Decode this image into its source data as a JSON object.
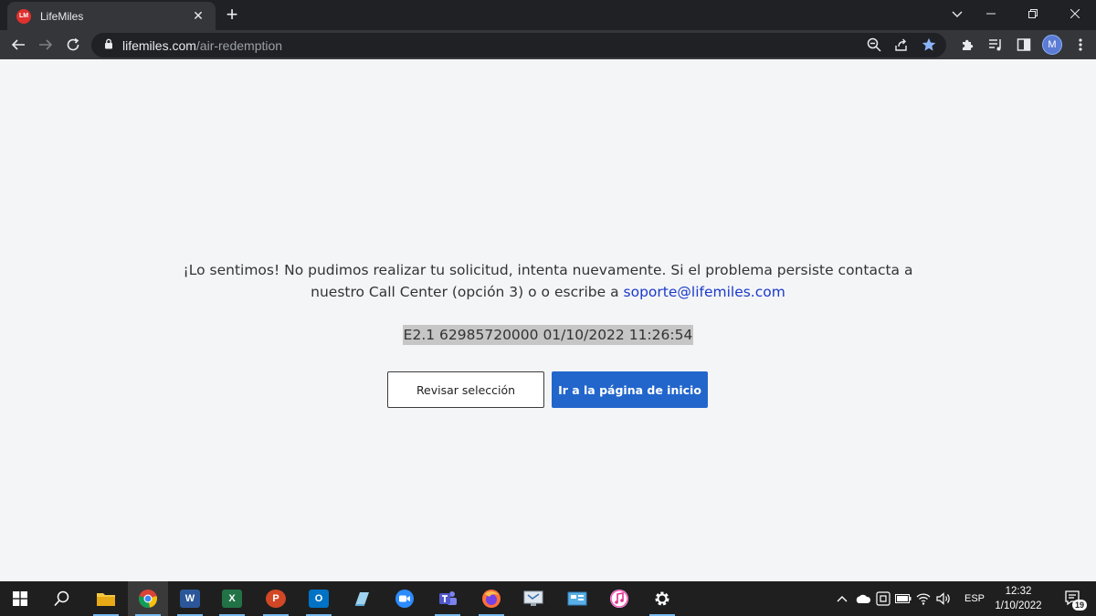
{
  "browser": {
    "tab_title": "LifeMiles",
    "favicon_text": "LM",
    "url_host": "lifemiles.com",
    "url_path": "/air-redemption",
    "profile_initial": "M"
  },
  "page": {
    "message_line1": "¡Lo sentimos! No pudimos realizar tu solicitud, intenta nuevamente. Si el problema persiste contacta a",
    "message_line2": "nuestro Call Center (opción 3) o o escribe a ",
    "support_email": "soporte@lifemiles.com",
    "error_code": "E2.1 62985720000 01/10/2022 11:26:54",
    "review_button": "Revisar selección",
    "home_button": "Ir a la página de inicio"
  },
  "taskbar": {
    "apps": [
      {
        "name": "file-explorer-icon",
        "label": ""
      },
      {
        "name": "chrome-icon",
        "label": ""
      },
      {
        "name": "word-icon",
        "label": "W"
      },
      {
        "name": "excel-icon",
        "label": "X"
      },
      {
        "name": "powerpoint-icon",
        "label": "P"
      },
      {
        "name": "outlook-icon",
        "label": "O"
      },
      {
        "name": "notepad-icon",
        "label": ""
      },
      {
        "name": "zoom-icon",
        "label": ""
      },
      {
        "name": "teams-icon",
        "label": ""
      },
      {
        "name": "firefox-icon",
        "label": ""
      },
      {
        "name": "remote-desktop-icon",
        "label": ""
      },
      {
        "name": "control-panel-icon",
        "label": ""
      },
      {
        "name": "itunes-icon",
        "label": ""
      },
      {
        "name": "settings-icon",
        "label": ""
      }
    ],
    "language": "ESP",
    "time": "12:32",
    "date": "1/10/2022",
    "notification_count": "19"
  },
  "colors": {
    "primary_button": "#2266cc",
    "link": "#1a3acb",
    "error_highlight": "#c6c6c6"
  }
}
